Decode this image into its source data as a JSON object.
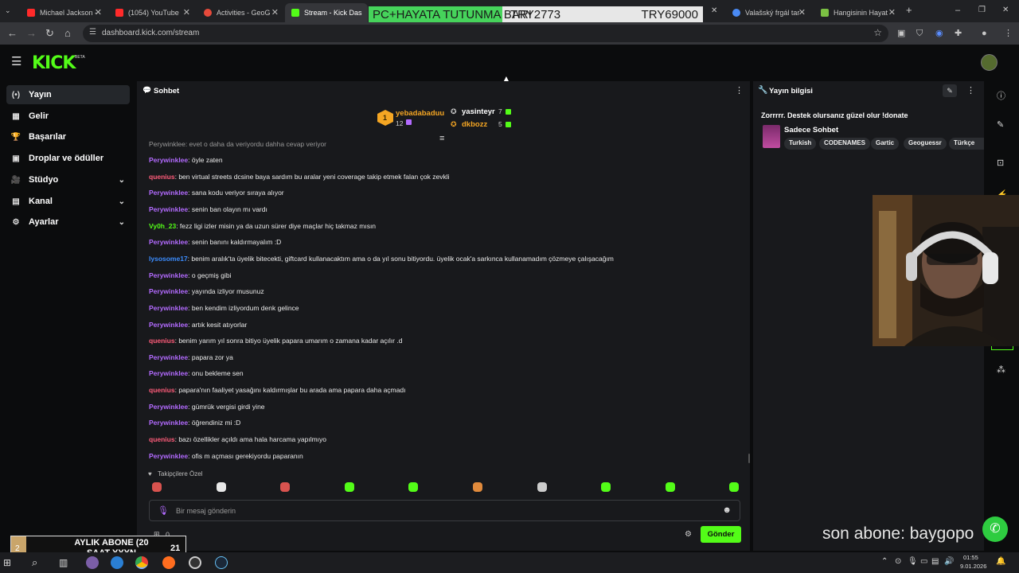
{
  "browser": {
    "tabs": [
      {
        "title": "Michael Jackson -",
        "fav_color": "#ff2a2a"
      },
      {
        "title": "(1054) YouTube",
        "fav_color": "#ff2a2a"
      },
      {
        "title": "Activities - GeoG",
        "fav_color": "#e64a3b"
      },
      {
        "title": "Stream - Kick Das",
        "fav_color": "#53fc18"
      },
      {
        "title": "Valašský frgál tar",
        "fav_color": "#4a8af4"
      },
      {
        "title": "Hangisinin Hayat",
        "fav_color": "#7bc043"
      }
    ],
    "new_tab": "+",
    "url": "dashboard.kick.com/stream",
    "window_controls": [
      "–",
      "❐",
      "✕"
    ]
  },
  "overlay": {
    "donation_left": "PC+HAYATA TUTUNMA BARI",
    "donation_mid": "TRY2773",
    "donation_right": "TRY69000",
    "sub_goal_title": "AYLIK ABONE (20 SAAT YYYN",
    "sub_goal_current": "2",
    "sub_goal_target": "21",
    "last_sub": "son abone: baygopo"
  },
  "kick": {
    "logo": "KICK",
    "beta": "BETA"
  },
  "sidebar": {
    "items": [
      {
        "icon": "(•)",
        "label": "Yayın",
        "active": true,
        "chevron": false
      },
      {
        "icon": "▦",
        "label": "Gelir",
        "active": false,
        "chevron": false
      },
      {
        "icon": "🏆",
        "label": "Başarılar",
        "active": false,
        "chevron": false
      },
      {
        "icon": "▣",
        "label": "Droplar ve ödüller",
        "active": false,
        "chevron": false
      },
      {
        "icon": "🎥",
        "label": "Stüdyo",
        "active": false,
        "chevron": true
      },
      {
        "icon": "▤",
        "label": "Kanal",
        "active": false,
        "chevron": true
      },
      {
        "icon": "⚙",
        "label": "Ayarlar",
        "active": false,
        "chevron": true
      }
    ]
  },
  "chat": {
    "title": "Sohbet",
    "leaderboard": [
      {
        "rank": "1",
        "name": "yebadabaduu",
        "count": "12",
        "color": "#f5a623"
      },
      {
        "name": "yasinteyr",
        "count": "7",
        "color": "#ffffff"
      },
      {
        "name": "dkbozz",
        "count": "5",
        "color": "#f5a623"
      }
    ],
    "partial_top": "Perywinklee: evet o daha da veriyordu dahha cevap veriyor",
    "messages": [
      {
        "user": "Perywinklee",
        "color": "#b36bff",
        "text": "öyle zaten"
      },
      {
        "user": "quenius",
        "color": "#ff5c7a",
        "text": "ben virtual streets dcsine baya sardım bu aralar yeni coverage takip etmek falan çok zevkli"
      },
      {
        "user": "Perywinklee",
        "color": "#b36bff",
        "text": "sana kodu veriyor sıraya alıyor"
      },
      {
        "user": "Perywinklee",
        "color": "#b36bff",
        "text": "senin ban olayın mı vardı"
      },
      {
        "user": "Vy0h_23",
        "color": "#53fc18",
        "text": "fezz ligi izler misin ya da uzun sürer diye maçlar hiç takmaz mısın"
      },
      {
        "user": "Perywinklee",
        "color": "#b36bff",
        "text": "senin banını kaldırmayalım :D"
      },
      {
        "user": "lysosome17",
        "color": "#3c8dff",
        "text": "benim aralık'ta üyelik bitecekti, giftcard kullanacaktım ama o da yıl sonu bitiyordu. üyelik ocak'a sarkınca kullanamadım çözmeye çalışacağım"
      },
      {
        "user": "Perywinklee",
        "color": "#b36bff",
        "text": "o geçmiş gibi"
      },
      {
        "user": "Perywinklee",
        "color": "#b36bff",
        "text": "yayında izliyor musunuz"
      },
      {
        "user": "Perywinklee",
        "color": "#b36bff",
        "text": "ben kendim izliyordum denk gelince"
      },
      {
        "user": "Perywinklee",
        "color": "#b36bff",
        "text": "artık kesit atıyorlar"
      },
      {
        "user": "quenius",
        "color": "#ff5c7a",
        "text": "benim yarım yıl sonra bitiyo üyelik papara umarım o zamana kadar açılır .d"
      },
      {
        "user": "Perywinklee",
        "color": "#b36bff",
        "text": "papara zor ya"
      },
      {
        "user": "Perywinklee",
        "color": "#b36bff",
        "text": "onu bekleme sen"
      },
      {
        "user": "quenius",
        "color": "#ff5c7a",
        "text": "papara'nın faaliyet yasağını kaldırmışlar bu arada ama papara daha açmadı"
      },
      {
        "user": "Perywinklee",
        "color": "#b36bff",
        "text": "gümrük vergisi girdi yine"
      },
      {
        "user": "Perywinklee",
        "color": "#b36bff",
        "text": "öğrendiniz mi :D"
      },
      {
        "user": "quenius",
        "color": "#ff5c7a",
        "text": "bazı özellikler açıldı ama hala harcama yapılmıyo"
      },
      {
        "user": "Perywinklee",
        "color": "#b36bff",
        "text": "ofis m açması gerekiyordu paparanın"
      }
    ],
    "followers_label": "Takipçilere Özel",
    "input_placeholder": "Bir mesaj gönderin",
    "send_label": "Gönder",
    "points": "0"
  },
  "stream_info": {
    "title": "Yayın bilgisi",
    "stream_title": "Zorrrrr. Destek olursanız güzel olur !donate",
    "category": "Sadece Sohbet",
    "tags": [
      "Turkish",
      "CODENAMES",
      "Gartic",
      "Geoguessr",
      "Türkçe"
    ]
  },
  "taskbar": {
    "time": "01:55",
    "date": "9.01.2026"
  },
  "colors": {
    "kick_green": "#53fc18",
    "panel": "#18191c",
    "bg": "#0b0c0d"
  }
}
